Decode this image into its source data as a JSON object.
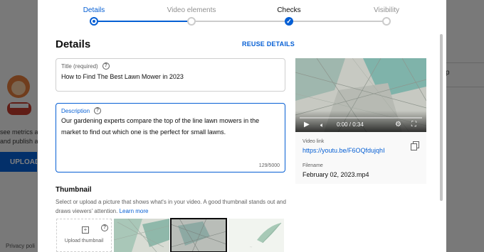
{
  "background": {
    "text_line1": "see metrics a",
    "text_line2": "and publish a",
    "upload_label": "UPLOAD",
    "side_letter": "p",
    "privacy": "Privacy poli"
  },
  "stepper": {
    "steps": [
      {
        "label": "Details",
        "state": "active"
      },
      {
        "label": "Video elements",
        "state": "pending"
      },
      {
        "label": "Checks",
        "state": "done"
      },
      {
        "label": "Visibility",
        "state": "pending"
      }
    ]
  },
  "details": {
    "heading": "Details",
    "reuse_label": "REUSE DETAILS",
    "title_field": {
      "label": "Title (required)",
      "value": "How to Find The Best Lawn Mower in 2023"
    },
    "description_field": {
      "label": "Description",
      "value": "Our gardening experts compare the top of the line lawn mowers in the market to find out which one is the perfect for small lawns.",
      "counter": "129/5000"
    }
  },
  "thumbnail": {
    "title": "Thumbnail",
    "description": "Select or upload a picture that shows what's in your video. A good thumbnail stands out and draws viewers' attention.",
    "learn_more": "Learn more",
    "upload_label": "Upload thumbnail"
  },
  "preview": {
    "time": "0:00 / 0:34",
    "video_link_label": "Video link",
    "video_link": "https://youtu.be/F6OQfdujqhI",
    "filename_label": "Filename",
    "filename": "February 02, 2023.mp4"
  },
  "colors": {
    "accent": "#065fd4",
    "map_teal": "#7fb3aa"
  }
}
